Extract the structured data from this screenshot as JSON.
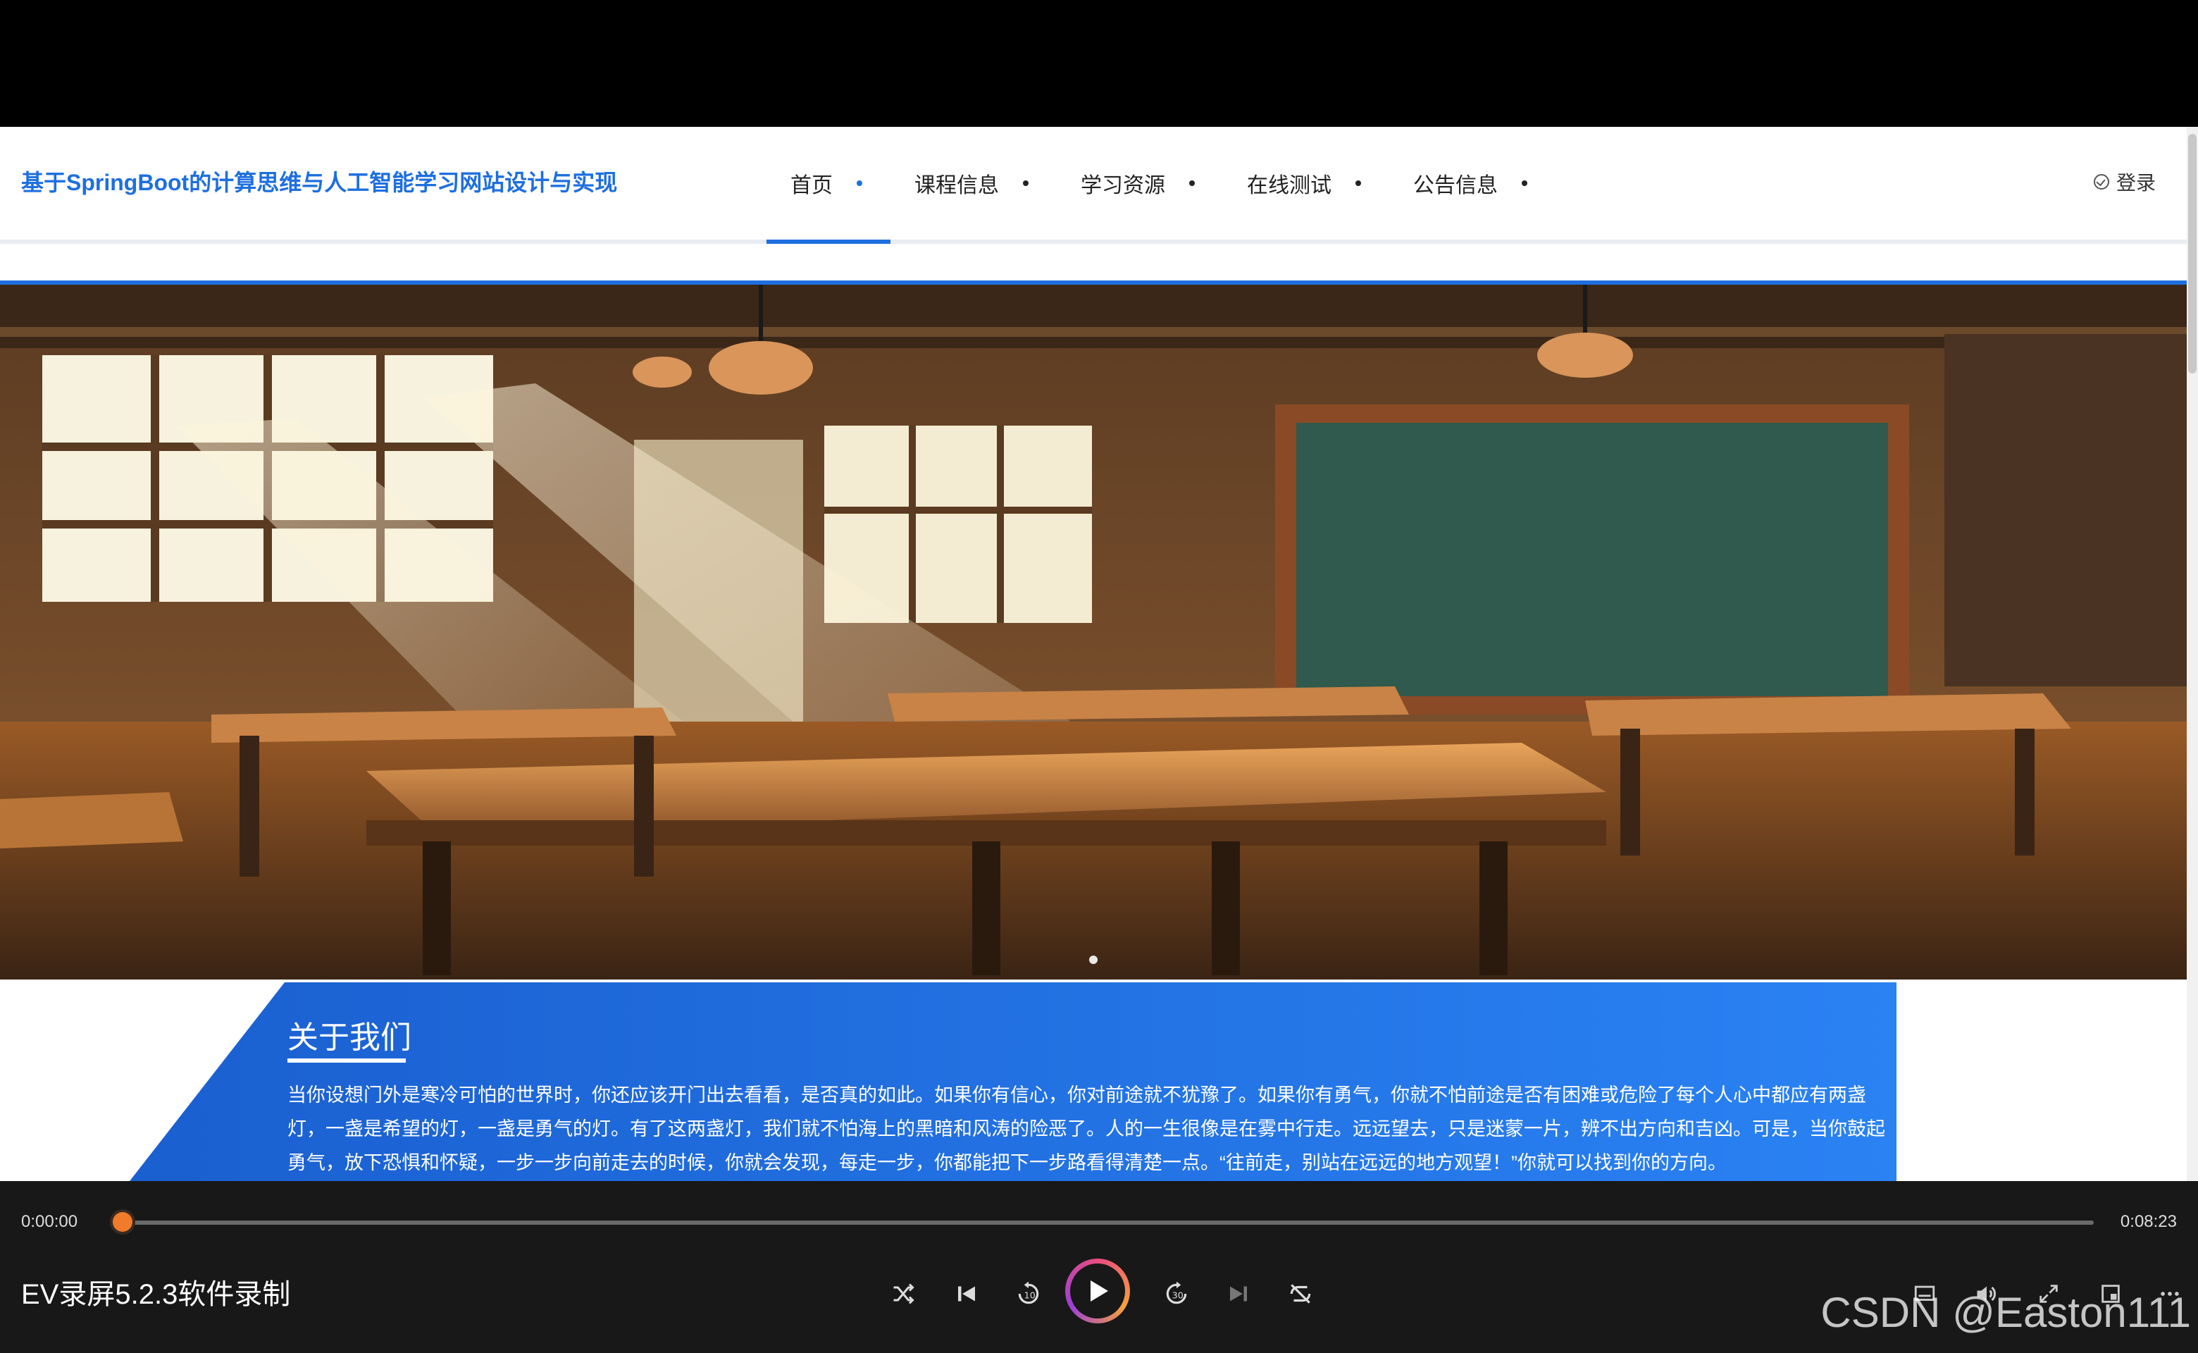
{
  "website": {
    "title": "基于SpringBoot的计算思维与人工智能学习网站设计与实现",
    "menu": [
      {
        "label": "首页",
        "active": true
      },
      {
        "label": "课程信息",
        "active": false
      },
      {
        "label": "学习资源",
        "active": false
      },
      {
        "label": "在线测试",
        "active": false
      },
      {
        "label": "公告信息",
        "active": false
      }
    ],
    "login_label": "登录",
    "accent_color": "#1e6fe0",
    "about": {
      "title": "关于我们",
      "text": "当你设想门外是寒冷可怕的世界时，你还应该开门出去看看，是否真的如此。如果你有信心，你对前途就不犹豫了。如果你有勇气，你就不怕前途是否有困难或危险了每个人心中都应有两盏灯，一盏是希望的灯，一盏是勇气的灯。有了这两盏灯，我们就不怕海上的黑暗和风涛的险恶了。人的一生很像是在雾中行走。远远望去，只是迷蒙一片，辨不出方向和吉凶。可是，当你鼓起勇气，放下恐惧和怀疑，一步一步向前走去的时候，你就会发现，每走一步，你都能把下一步路看得清楚一点。“往前走，别站在远远的地方观望！”你就可以找到你的方向。"
    }
  },
  "player": {
    "current_time": "0:00:00",
    "total_time": "0:08:23",
    "progress": 0.0,
    "recording_label": "EV录屏5.2.3软件录制",
    "controls": [
      "shuffle-icon",
      "previous-icon",
      "rewind-10-icon",
      "play-icon",
      "forward-30-icon",
      "next-icon",
      "repeat-off-icon",
      "subtitle-icon",
      "volume-icon",
      "fullscreen-icon",
      "mini-player-icon",
      "more-icon"
    ],
    "watermark": "CSDN @Easton111"
  }
}
